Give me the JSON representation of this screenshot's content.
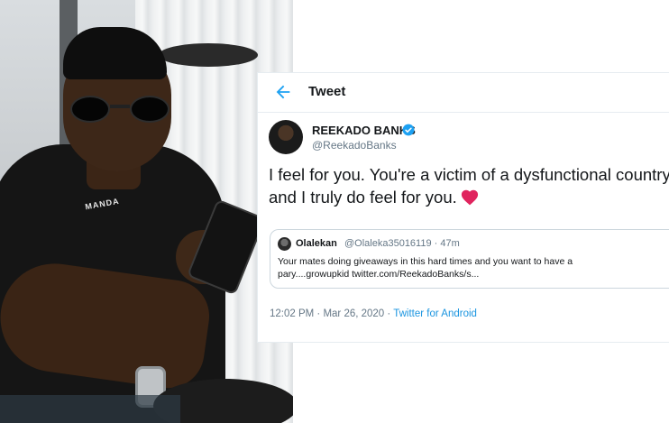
{
  "header": {
    "title": "Tweet"
  },
  "tweet": {
    "author_name": "REEKADO BANKS",
    "author_handle": "@ReekadoBanks",
    "text": "I feel for you. You're a victim of a dysfunctional country and I truly do feel for you.",
    "heart": "❤",
    "timestamp": "12:02 PM · Mar 26, 2020",
    "separator": " · ",
    "source": "Twitter for Android"
  },
  "quoted": {
    "author_name": "Olalekan",
    "author_handle": "@Olaleka35016119 · 47m",
    "text": "Your mates doing giveaways in this hard times and you want to have a pary....growupkid twitter.com/ReekadoBanks/s..."
  },
  "photo": {
    "chain_text": "MANDA"
  },
  "colors": {
    "accent": "#1da1f2",
    "link": "#1b95e0",
    "heart": "#e0245e",
    "muted": "#657786",
    "border": "#e6ecf0"
  },
  "icons": {
    "back": "back-arrow-icon",
    "verified": "verified-badge-icon",
    "heart": "heart-icon"
  }
}
